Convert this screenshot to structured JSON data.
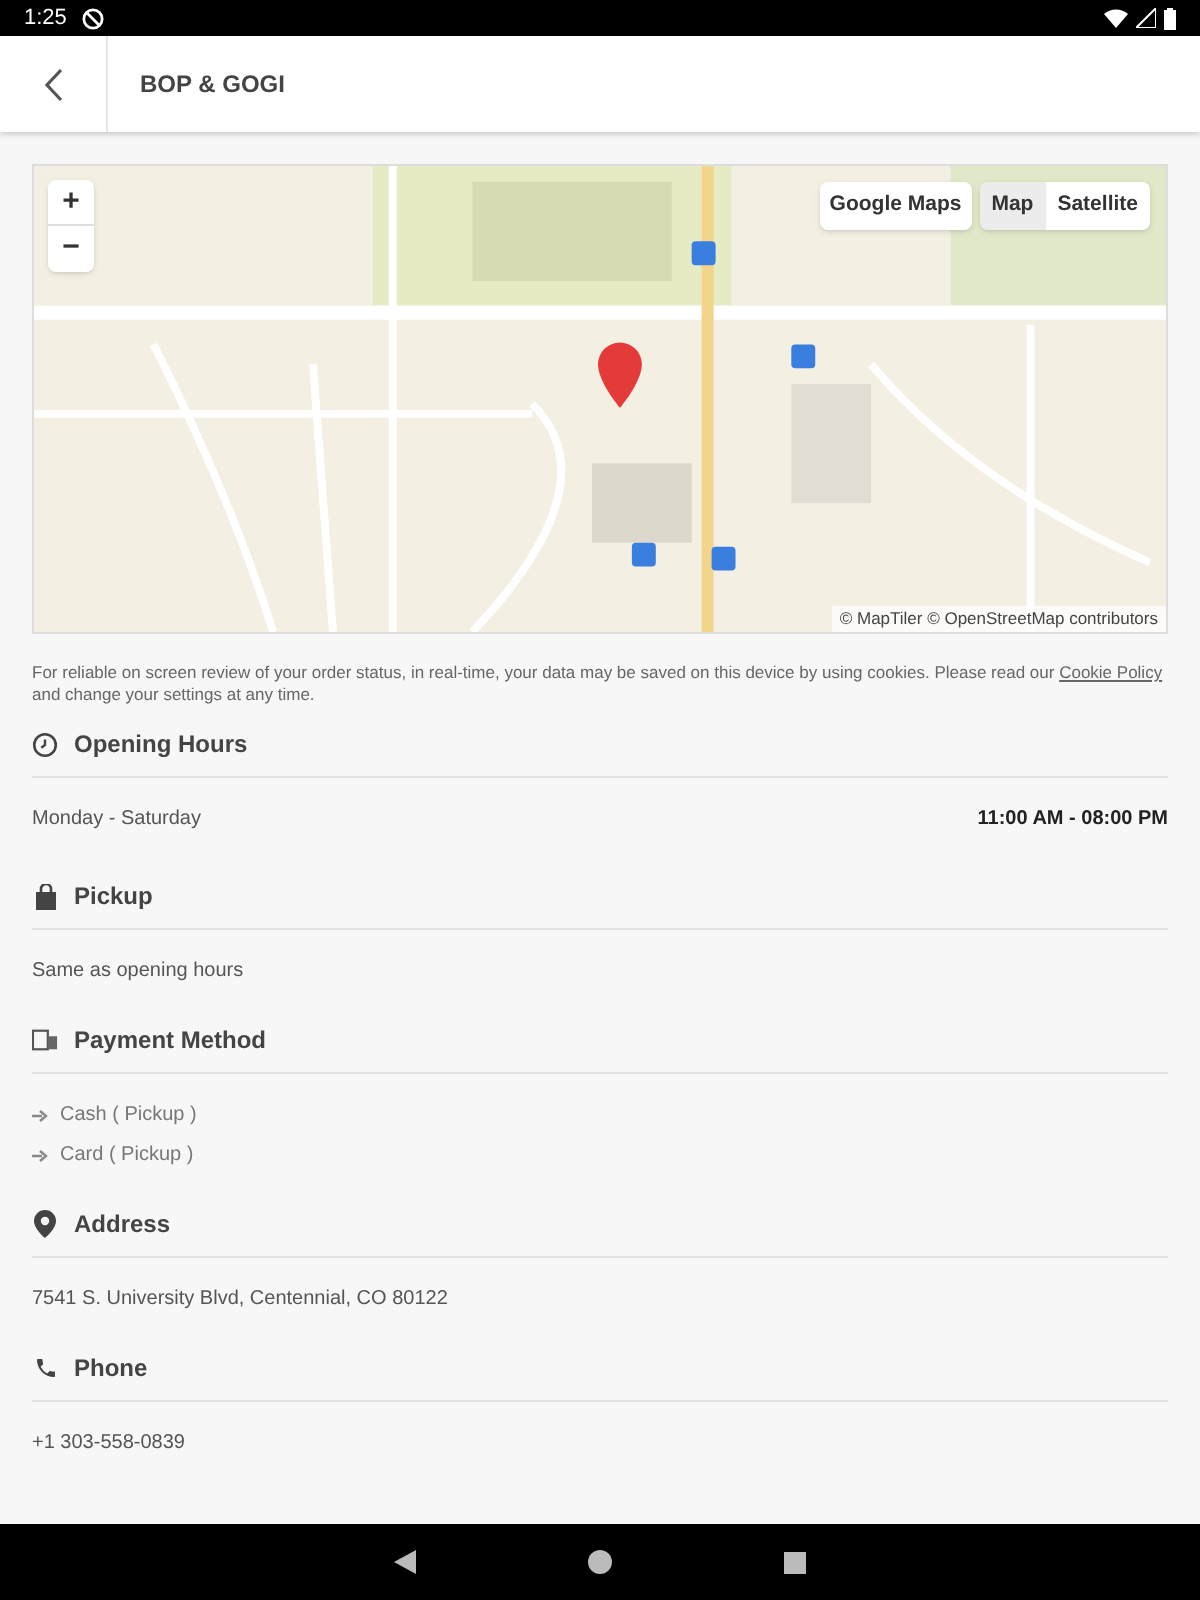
{
  "status_bar": {
    "time": "1:25"
  },
  "header": {
    "title": "BOP & GOGI"
  },
  "map": {
    "zoom_in": "+",
    "zoom_out": "−",
    "external_link": "Google Maps",
    "map_types": [
      {
        "label": "Map",
        "selected": true
      },
      {
        "label": "Satellite",
        "selected": false
      }
    ],
    "attribution": "© MapTiler © OpenStreetMap contributors"
  },
  "cookie_notice": {
    "text": "For reliable on screen review of your order status, in real-time, your data may be saved on this device by using cookies. Please read our",
    "link": "Cookie Policy",
    "text_after": "and change your settings at any time."
  },
  "sections": [
    {
      "kind": "hours",
      "title": "Opening Hours",
      "rows": [
        {
          "days": "Monday - Saturday",
          "hours": "11:00 AM - 08:00 PM"
        }
      ]
    },
    {
      "kind": "text",
      "title": "Pickup",
      "text": "Same as opening hours"
    },
    {
      "kind": "list",
      "title": "Payment Method",
      "items": [
        "Cash ( Pickup )",
        "Card ( Pickup )"
      ]
    },
    {
      "kind": "text",
      "title": "Address",
      "text": "7541 S. University Blvd, Centennial, CO 80122"
    },
    {
      "kind": "text",
      "title": "Phone",
      "text": "+1 303-558-0839"
    }
  ]
}
